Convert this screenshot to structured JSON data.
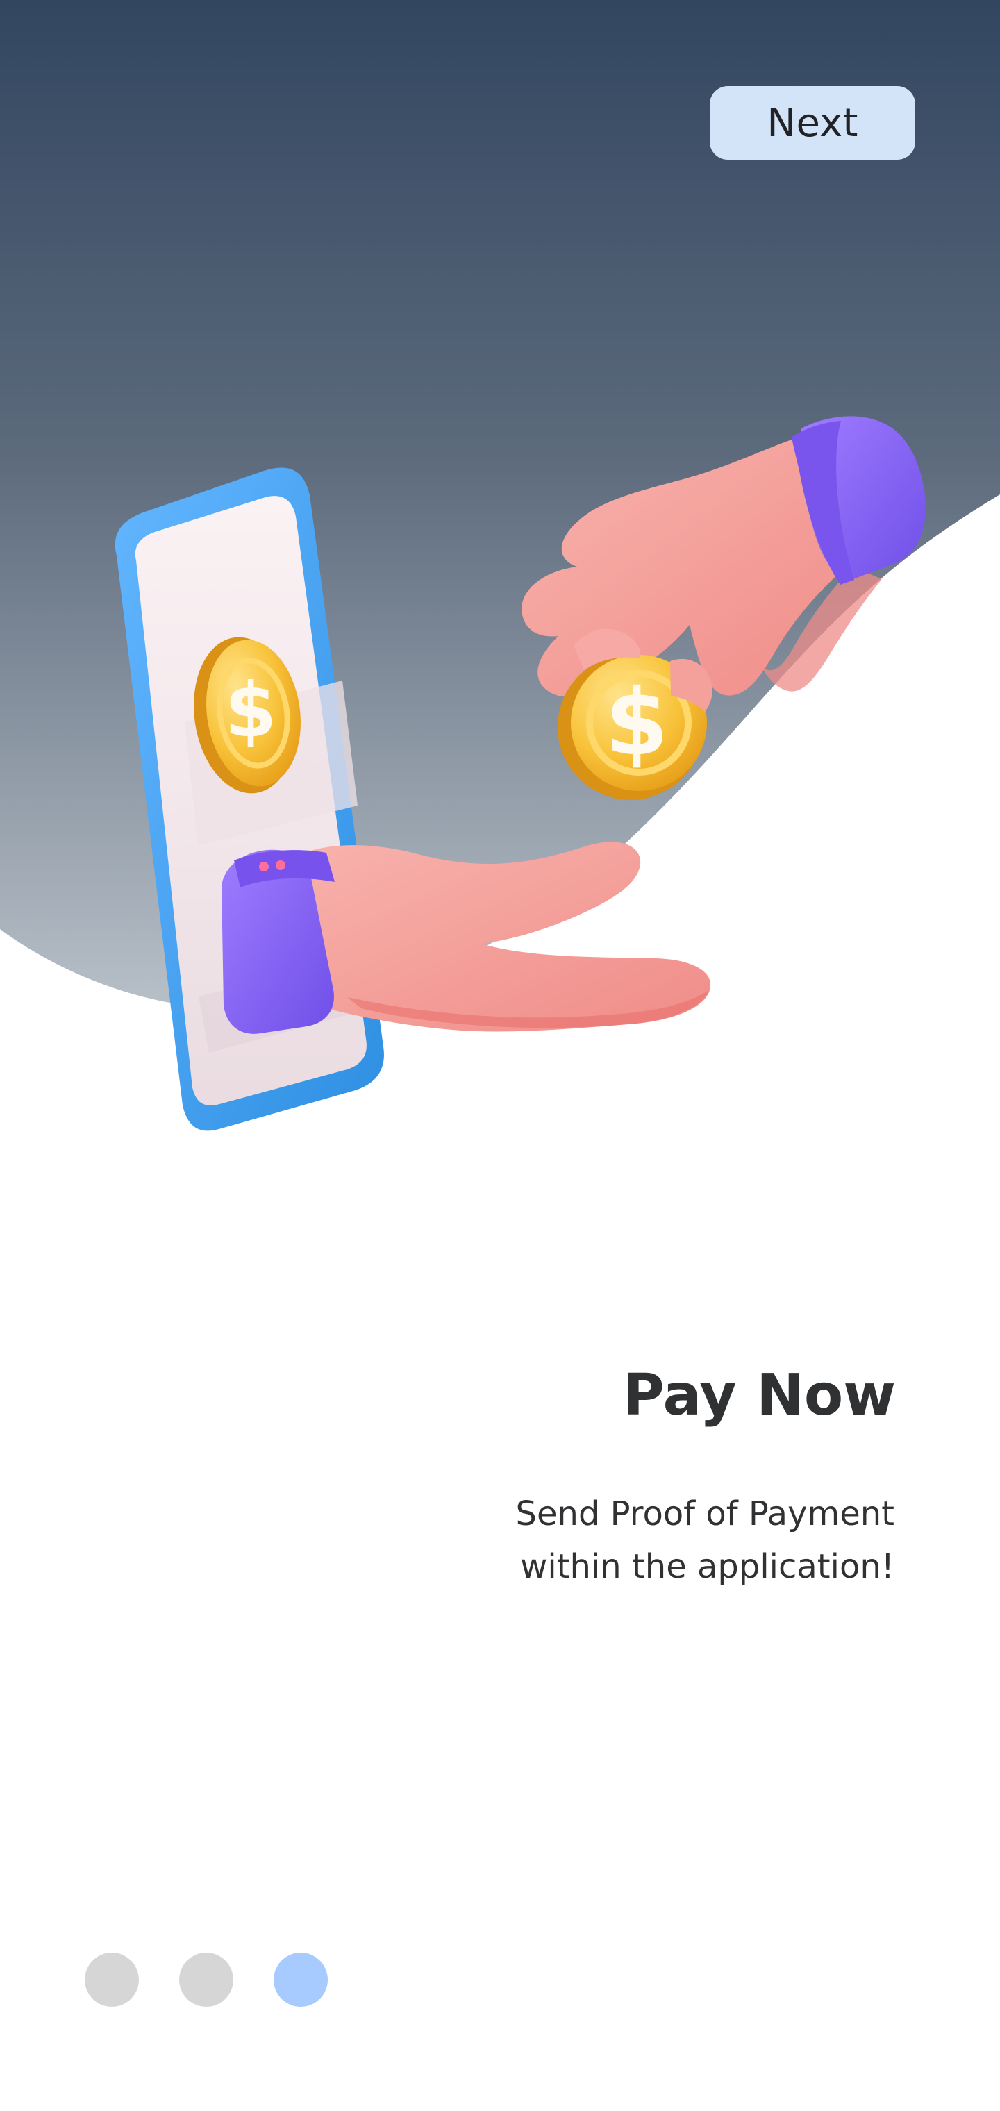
{
  "header": {
    "next_label": "Next"
  },
  "content": {
    "title": "Pay Now",
    "subtitle": "Send Proof of Payment\nwithin the application!"
  },
  "pagination": {
    "current_page": 3,
    "total_pages": 3,
    "inactive_color": "#d6d6d6",
    "active_color": "#a7cbff"
  },
  "colors": {
    "hero_gradient_top": "#344760",
    "hero_gradient_bottom": "#b0b8c0",
    "button_bg": "#d3e3f8",
    "text": "#303133",
    "phone_frame": "#3aa0ef",
    "coin": "#f7bd2d",
    "sleeve": "#875ef0",
    "hand": "#f4a49e"
  },
  "illustration": {
    "name": "payment-illustration",
    "coin_symbol": "$"
  }
}
